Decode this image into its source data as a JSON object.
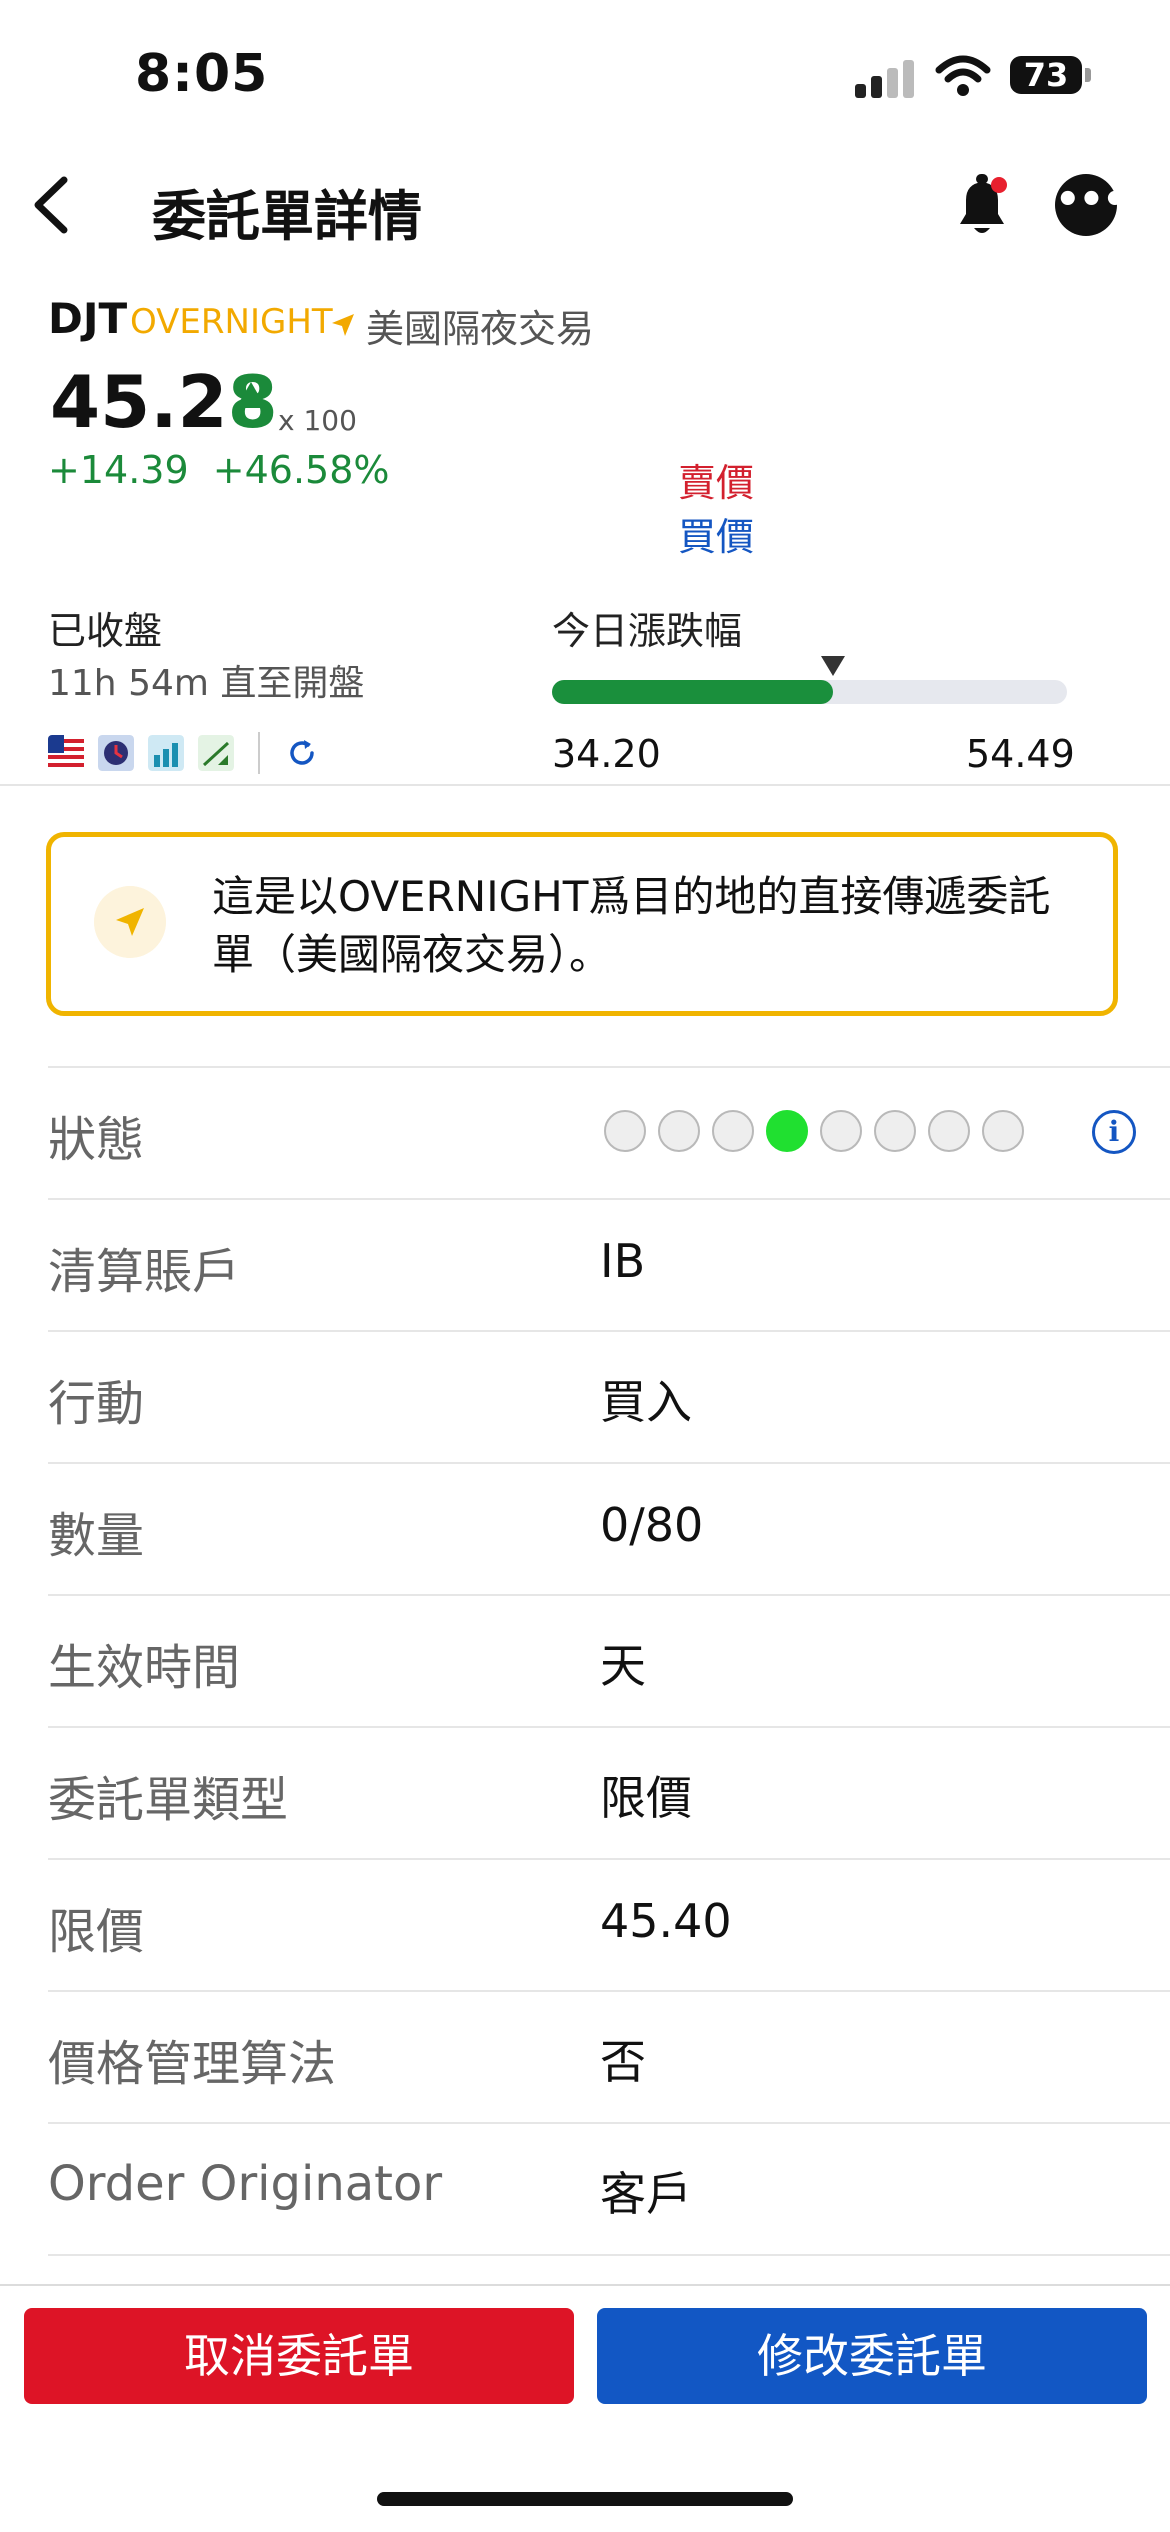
{
  "status_bar": {
    "time": "8:05",
    "battery": "73"
  },
  "nav": {
    "title": "委託單詳情"
  },
  "ticker": {
    "symbol": "DJT",
    "venue": "OVERNIGHT",
    "venue_desc": "美國隔夜交易",
    "price_main": "45.2",
    "price_last_digit": "8",
    "multiplier": "x 100",
    "change": "+14.39  +46.58%",
    "ask_label": "賣價",
    "bid_label": "買價"
  },
  "market": {
    "status": "已收盤",
    "open_in": "11h 54m 直至開盤",
    "range_label": "今日漲跌幅",
    "range_low": "34.20",
    "range_high": "54.49",
    "current_price": 45.28
  },
  "notice": {
    "text": "這是以OVERNIGHT爲目的地的直接傳遞委託單（美國隔夜交易）。"
  },
  "status_row": {
    "label": "狀態",
    "steps_total": 8,
    "active_step": 4
  },
  "details": [
    {
      "label": "清算賬戶",
      "value": "IB"
    },
    {
      "label": "行動",
      "value": "買入"
    },
    {
      "label": "數量",
      "value": "0/80"
    },
    {
      "label": "生效時間",
      "value": "天"
    },
    {
      "label": "委託單類型",
      "value": "限價"
    },
    {
      "label": "限價",
      "value": "45.40"
    },
    {
      "label": "價格管理算法",
      "value": "否"
    },
    {
      "label": "Order Originator",
      "value": "客戶"
    }
  ],
  "buttons": {
    "cancel": "取消委託單",
    "modify": "修改委託單"
  },
  "colors": {
    "up": "#1b8a3a",
    "ask": "#d3202e",
    "bid": "#1456c2",
    "cancel": "#dd1426",
    "modify": "#1257c4",
    "notice_border": "#f0b400"
  }
}
